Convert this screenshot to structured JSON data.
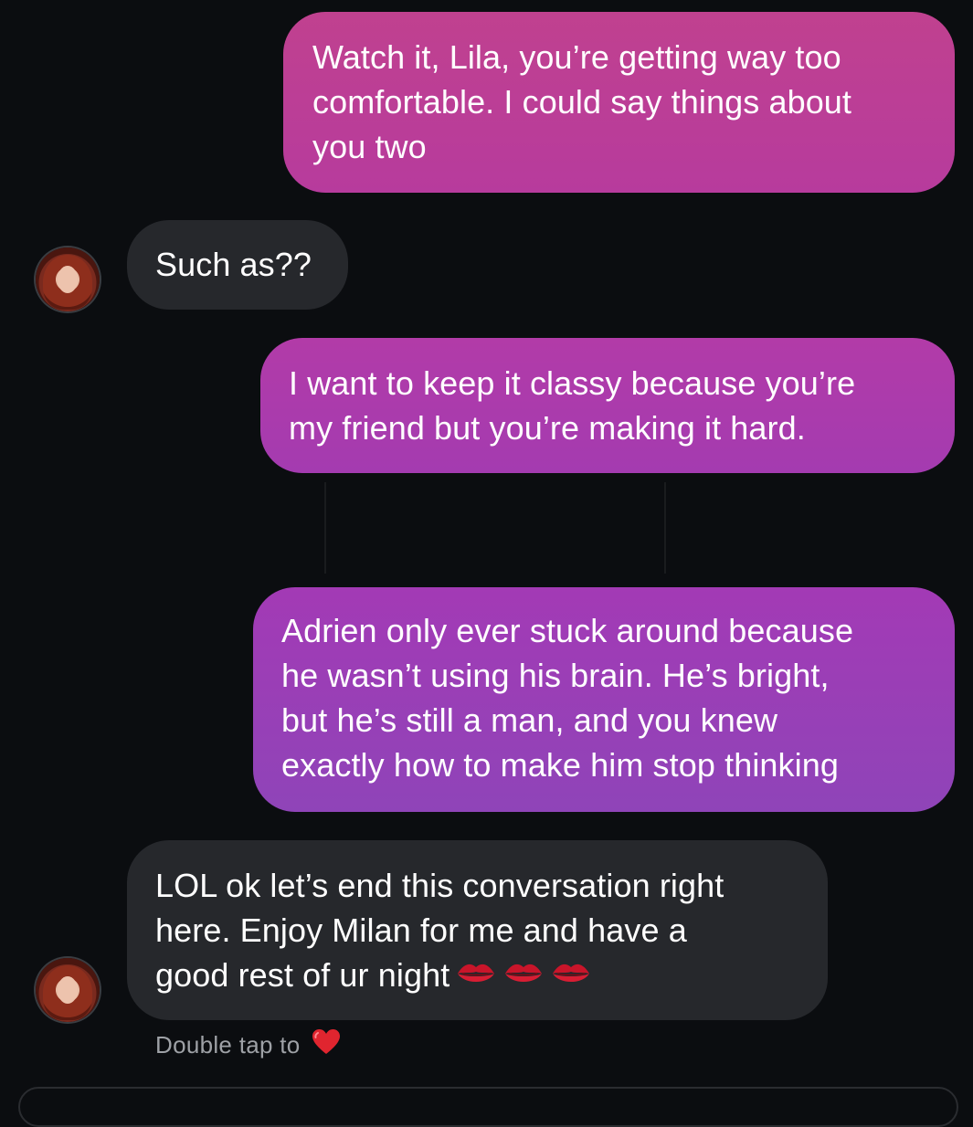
{
  "conversation": {
    "messages": [
      {
        "direction": "sent",
        "lines": [
          "Watch it, Lila, you’re getting way too",
          "comfortable. I could say things about",
          "you two"
        ]
      },
      {
        "direction": "received",
        "lines": [
          "Such as??"
        ]
      },
      {
        "direction": "sent",
        "lines": [
          "I want to keep it classy because you’re",
          "my friend but you’re making it hard."
        ]
      },
      {
        "direction": "sent",
        "lines": [
          "Adrien only ever stuck around because",
          "he wasn’t using his brain. He’s bright,",
          "but he’s still a man, and you knew",
          "exactly how to make him stop thinking"
        ]
      },
      {
        "direction": "received",
        "lines": [
          "LOL ok let’s end this conversation right",
          "here. Enjoy Milan for me and have a",
          "good rest of ur night"
        ],
        "emoji": [
          "kiss-mark-icon",
          "kiss-mark-icon",
          "kiss-mark-icon"
        ]
      }
    ],
    "reaction_hint": {
      "text": "Double tap to",
      "icon": "red-heart-icon"
    }
  },
  "colors": {
    "background": "#0b0d10",
    "received_bubble": "#26282c",
    "sent_bubble_top": "#c0418f",
    "sent_bubble_bottom": "#8f44b8",
    "hint_text": "#9ea1a6",
    "heart": "#e0252f"
  }
}
